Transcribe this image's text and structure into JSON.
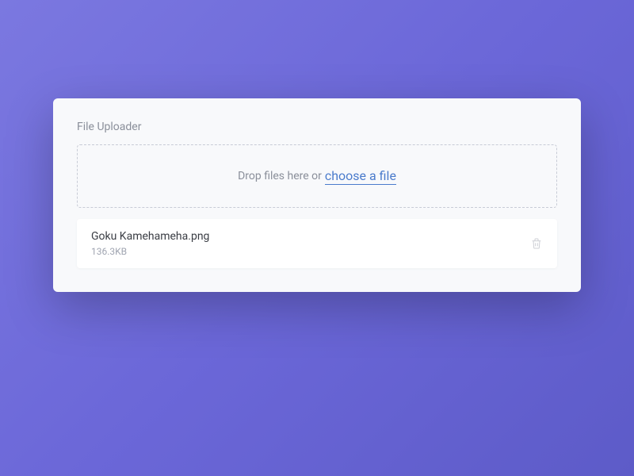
{
  "uploader": {
    "title": "File Uploader",
    "dropzone_text": "Drop files here or",
    "choose_link": "choose a file"
  },
  "file": {
    "name": "Goku Kamehameha.png",
    "size": "136.3KB"
  }
}
